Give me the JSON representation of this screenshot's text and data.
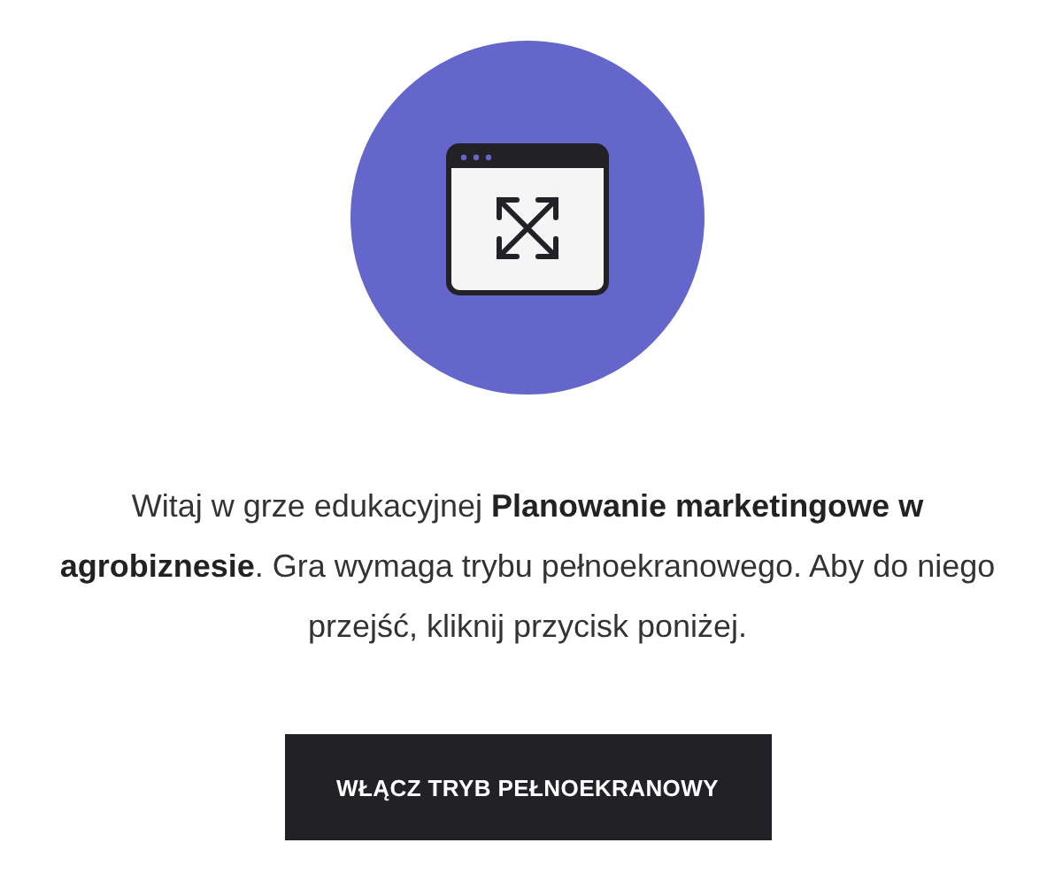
{
  "intro": {
    "text": "Witaj w grze edukacyjnej **Planowanie marketingowe w agrobiznesie**. Gra wymaga trybu pełnoekranowego. Aby do niego przejść, kliknij przycisk poniżej."
  },
  "button": {
    "label": "WŁĄCZ TRYB PEŁNOEKRANOWY"
  }
}
